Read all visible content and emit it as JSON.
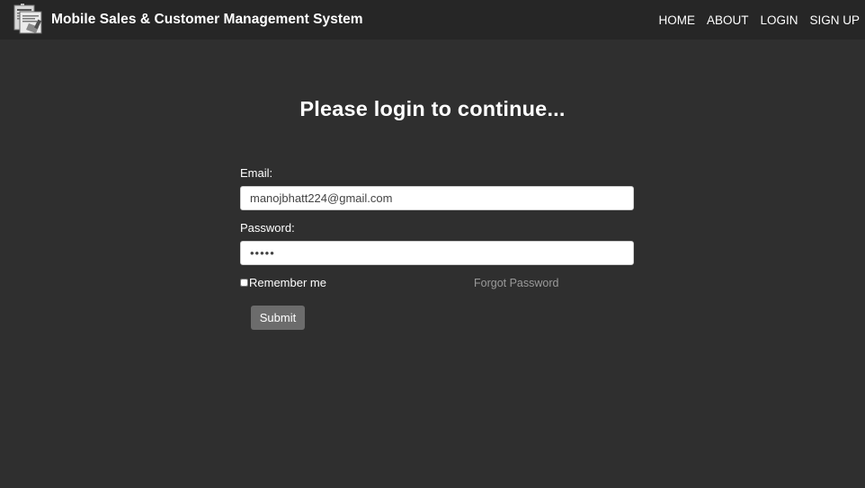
{
  "header": {
    "brand_title": "Mobile Sales & Customer Management System",
    "logo_icon": "document-stamp-icon",
    "nav": [
      {
        "label": "HOME"
      },
      {
        "label": "ABOUT"
      },
      {
        "label": "LOGIN"
      },
      {
        "label": "SIGN UP"
      }
    ]
  },
  "login_form": {
    "heading": "Please login to continue...",
    "email_label": "Email:",
    "email_value": "manojbhatt224@gmail.com",
    "password_label": "Password:",
    "password_value": "•••••",
    "remember_label": "Remember me",
    "remember_checked": false,
    "forgot_link": "Forgot Password",
    "submit_label": "Submit"
  },
  "colors": {
    "page_background": "#2f2f2f",
    "navbar_background": "#262626",
    "button_background": "#6c6c6c",
    "link_muted": "#9a9a9a"
  }
}
